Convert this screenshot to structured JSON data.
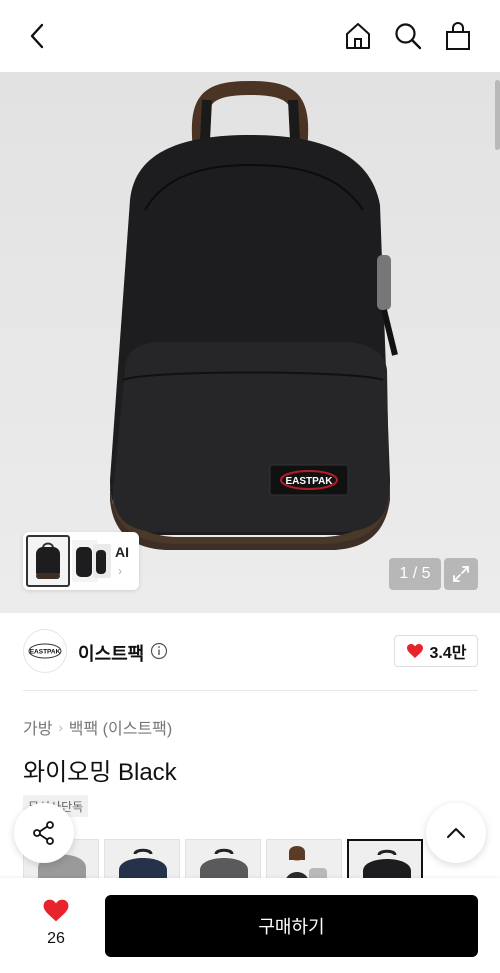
{
  "header": {
    "back_icon": "chevron-left-icon",
    "home_icon": "home-icon",
    "search_icon": "search-icon",
    "cart_icon": "shopping-bag-icon"
  },
  "gallery": {
    "ai_label": "AI",
    "counter": "1 / 5",
    "expand_icon": "expand-icon"
  },
  "brand": {
    "name": "이스트팩",
    "logo_text": "EASTPAK",
    "like_count": "3.4만"
  },
  "breadcrumb": [
    "가방",
    "백팩 (이스트팩)"
  ],
  "product": {
    "title": "와이오밍 Black",
    "exclusive_badge": "무신사단독"
  },
  "colors": {
    "accent": "#000000",
    "heart": "#e8232b"
  },
  "bottom": {
    "wish_count": "26",
    "buy_label": "구매하기"
  }
}
